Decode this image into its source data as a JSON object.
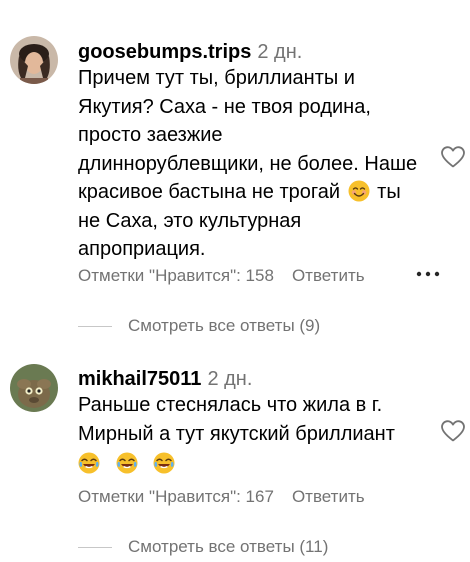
{
  "comments": [
    {
      "username": "goosebumps.trips",
      "time": "2 дн.",
      "lines": [
        "Причем тут ты, бриллианты и",
        "Якутия? Саха - не твоя родина,",
        "просто заезжие",
        "длиннорублевщики, не более. Наше"
      ],
      "line5_before": "красивое бастына не трогай",
      "line5_after": "ты",
      "lines_end": [
        "не Саха, это культурная",
        "апроприация."
      ],
      "likes_label": "Отметки \"Нравится\": 158",
      "reply_label": "Ответить",
      "view_replies": "Смотреть все ответы (9)"
    },
    {
      "username": "mikhail75011",
      "time": "2 дн.",
      "lines": [
        "Раньше стеснялась что жила в г.",
        "Мирный а тут якутский бриллиант"
      ],
      "likes_label": "Отметки \"Нравится\": 167",
      "reply_label": "Ответить",
      "view_replies": "Смотреть все ответы (11)"
    }
  ],
  "icons": {
    "like": "heart-outline-icon",
    "more": "more-dots-icon",
    "smile_emoji": "smiling-face-emoji",
    "laugh_emoji": "tears-of-joy-emoji"
  },
  "colors": {
    "secondary_text": "#737373",
    "emoji_yellow": "#f7c02b"
  }
}
